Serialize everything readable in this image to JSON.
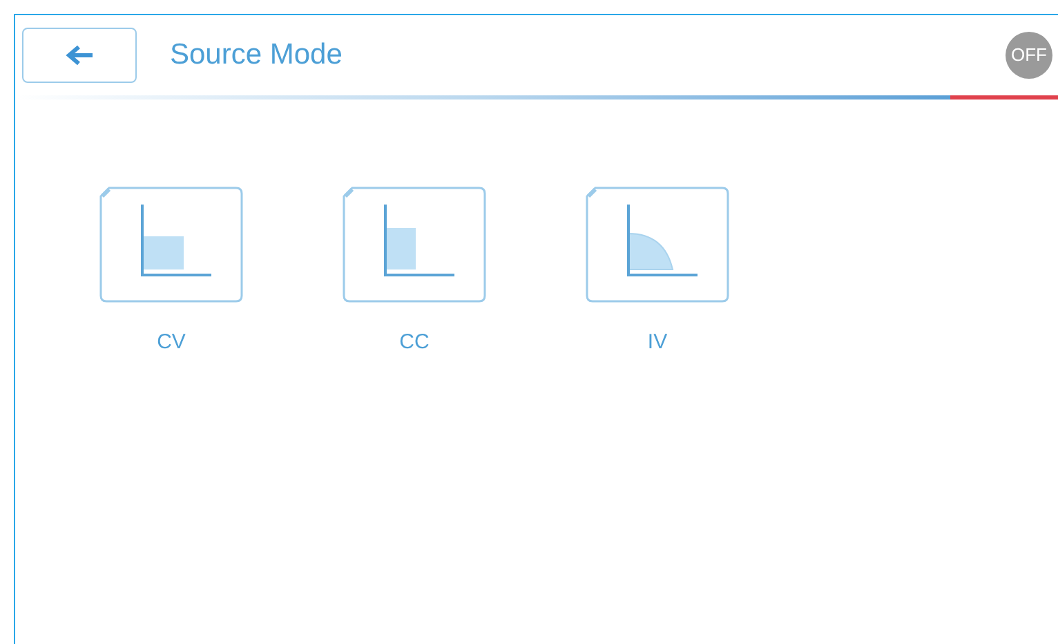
{
  "header": {
    "title": "Source Mode",
    "output_badge": "OFF"
  },
  "modes": [
    {
      "kind": "cv",
      "label": "CV"
    },
    {
      "kind": "cc",
      "label": "CC"
    },
    {
      "kind": "iv",
      "label": "IV"
    }
  ]
}
